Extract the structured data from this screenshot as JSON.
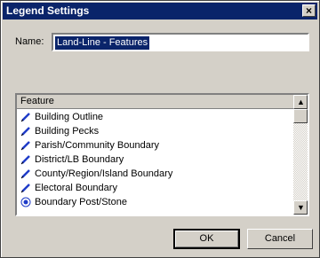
{
  "window": {
    "title": "Legend Settings",
    "close_label": "×"
  },
  "name": {
    "label": "Name:",
    "value": "Land-Line - Features"
  },
  "list": {
    "header": "Feature",
    "items": [
      {
        "label": "Building Outline",
        "icon": "pen-icon"
      },
      {
        "label": "Building Pecks",
        "icon": "pen-icon"
      },
      {
        "label": "Parish/Community Boundary",
        "icon": "pen-icon"
      },
      {
        "label": "District/LB Boundary",
        "icon": "pen-icon"
      },
      {
        "label": "County/Region/Island Boundary",
        "icon": "pen-icon"
      },
      {
        "label": "Electoral Boundary",
        "icon": "pen-icon"
      },
      {
        "label": "Boundary Post/Stone",
        "icon": "point-icon"
      }
    ]
  },
  "buttons": {
    "ok": "OK",
    "cancel": "Cancel"
  },
  "colors": {
    "dialog_bg": "#d4d0c8",
    "titlebar": "#0a246a",
    "selection": "#0a246a",
    "icon_blue": "#1f3cc8"
  }
}
